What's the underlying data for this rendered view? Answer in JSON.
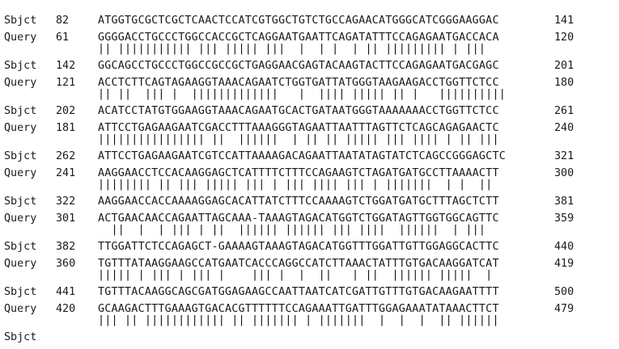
{
  "blocks": [
    {
      "query": {
        "label": "Query",
        "start": "",
        "seq": "",
        "end": ""
      },
      "match": "",
      "sbjct": {
        "label": "Sbjct",
        "start": "82",
        "seq": "ATGGTGCGCTCGCTCAACTCCATCGTGGCTGTCTGCCAGAACATGGGCATCGGGAAGGAC",
        "end": "141"
      }
    },
    {
      "query": {
        "label": "Query",
        "start": "61",
        "seq": "GGGGACCTGCCCTGGCCACCGCTCAGGAATGAATTCAGATATTTCCAGAGAATGACCACA",
        "end": "120"
      },
      "match": "|| ||||||||||| ||| ||||| |||  |  | |  | || ||||||||| | |||  ",
      "sbjct": {
        "label": "Sbjct",
        "start": "142",
        "seq": "GGCAGCCTGCCCTGGCCGCCGCTGAGGAACGAGTACAAGTACTTCCAGAGAATGACGAGC",
        "end": "201"
      }
    },
    {
      "query": {
        "label": "Query",
        "start": "121",
        "seq": "ACCTCTTCAGTAGAAGGTAAACAGAATCTGGTGATTATGGGTAAGAAGACCTGGTTCTCC",
        "end": "180"
      },
      "match": "|| ||  ||| |  |||||||||||||   |  |||| ||||| || |   ||||||||||",
      "sbjct": {
        "label": "Sbjct",
        "start": "202",
        "seq": "ACATCCTATGTGGAAGGTAAACAGAATGCACTGATAATGGGTAAAAAAACCTGGTTCTCC",
        "end": "261"
      }
    },
    {
      "query": {
        "label": "Query",
        "start": "181",
        "seq": "ATTCCTGAGAAGAATCGACCTTTAAAGGGTAGAATTAATTTAGTTCTCAGCAGAGAACTC",
        "end": "240"
      },
      "match": "|||||||||||||||| ||  ||||||  | || || ||||| ||| |||| | || ||| ",
      "sbjct": {
        "label": "Sbjct",
        "start": "262",
        "seq": "ATTCCTGAGAAGAATCGTCCATTAAAAGACAGAATTAATATAGTATCTCAGCCGGGAGCTC",
        "end": "321"
      }
    },
    {
      "query": {
        "label": "Query",
        "start": "241",
        "seq": "AAGGAACCTCCACAAGGAGCTCATTTTCTTTCCAGAAGTCTAGATGATGCCTTAAAACTT",
        "end": "300"
      },
      "match": "|||||||| || ||| ||||| ||| | ||| |||| ||| | |||||||  | |  || ",
      "sbjct": {
        "label": "Sbjct",
        "start": "322",
        "seq": "AAGGAACCACCAAAAGGAGCACATTATCTTTCCAAAAGTCTGGATGATGCTTTAGCTCTT",
        "end": "381"
      }
    },
    {
      "query": {
        "label": "Query",
        "start": "301",
        "seq": "ACTGAACAACCAGAATTAGCAAA-TAAAGTAGACATGGTCTGGATAGTTGGTGGCAGTTC",
        "end": "359"
      },
      "match": "  ||  |  | ||| | ||  |||||| |||||| ||| ||||  ||||||  | ||| ",
      "sbjct": {
        "label": "Sbjct",
        "start": "382",
        "seq": "TTGGATTCTCCAGAGCT-GAAAAGTAAAGTAGACATGGTTTGGATTGTTGGAGGCACTTC",
        "end": "440"
      }
    },
    {
      "query": {
        "label": "Query",
        "start": "360",
        "seq": "TGTTTATAAGGAAGCCATGAATCACCCAGGCCATCTTAAACTATTTGTGACAAGGATCAT",
        "end": "419"
      },
      "match": "||||| | ||| | ||| |    ||| |  |  ||   | ||  |||||| |||||  |  ",
      "sbjct": {
        "label": "Sbjct",
        "start": "441",
        "seq": "TGTTTACAAGGCAGCGATGGAGAAGCCAATTAATCATCGATTGTTTGTGACAAGAATTTT",
        "end": "500"
      }
    },
    {
      "query": {
        "label": "Query",
        "start": "420",
        "seq": "GCAAGACTTTGAAAGTGACACGTTTTTTCCAGAAATTGATTTGGAGAAATATAAACTTCT",
        "end": "479"
      },
      "match": "||| || |||||||||||| || ||||||| | |||||||  |  |  |  || |||||| ",
      "sbjct": {
        "label": "Sbjct",
        "start": "",
        "seq": "",
        "end": ""
      }
    }
  ]
}
